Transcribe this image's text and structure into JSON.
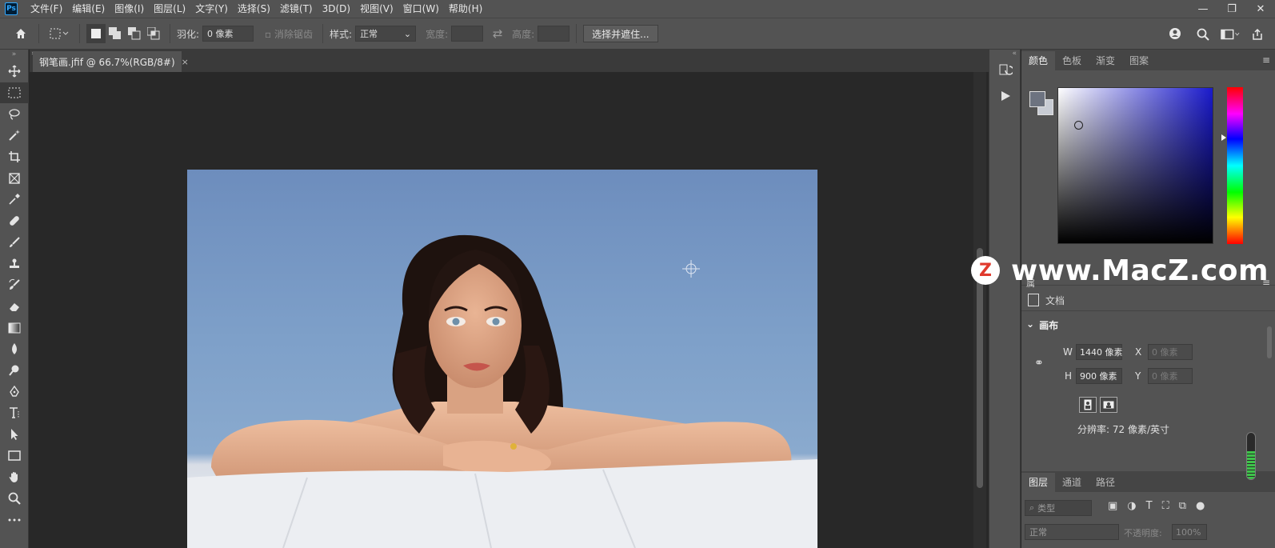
{
  "app": {
    "logo_text": "Ps"
  },
  "menu": [
    "文件(F)",
    "编辑(E)",
    "图像(I)",
    "图层(L)",
    "文字(Y)",
    "选择(S)",
    "滤镜(T)",
    "3D(D)",
    "视图(V)",
    "窗口(W)",
    "帮助(H)"
  ],
  "window_controls": {
    "minimize": "—",
    "restore": "❐",
    "close": "✕"
  },
  "options": {
    "feather_label": "羽化:",
    "feather_value": "0 像素",
    "antialias_label": "消除锯齿",
    "style_label": "样式:",
    "style_value": "正常",
    "width_label": "宽度:",
    "height_label": "高度:",
    "select_mask_button": "选择并遮住..."
  },
  "tools": [
    "move",
    "marquee",
    "lasso",
    "magic-wand",
    "crop",
    "frame",
    "eyedropper",
    "healing",
    "brush",
    "stamp",
    "history-brush",
    "eraser",
    "gradient",
    "blur",
    "dodge",
    "pen",
    "type",
    "path-select",
    "rectangle",
    "hand",
    "zoom",
    "more"
  ],
  "document": {
    "tab_title": "钢笔画.jfif @ 66.7%(RGB/8#)",
    "close": "×"
  },
  "color_panel": {
    "tabs": [
      "颜色",
      "色板",
      "渐变",
      "图案"
    ],
    "foreground": "#6d7380",
    "background": "#c8ccd4",
    "hue_color": "#1a1acc"
  },
  "watermark": {
    "logo": "Z",
    "text": "www.MacZ.com"
  },
  "properties": {
    "title": "属",
    "doc_label": "文档",
    "canvas_label": "画布",
    "w_label": "W",
    "w_value": "1440 像素",
    "h_label": "H",
    "h_value": "900 像素",
    "x_label": "X",
    "x_value": "0 像素",
    "y_label": "Y",
    "y_value": "0 像素",
    "resolution": "分辨率: 72 像素/英寸"
  },
  "layers_panel": {
    "tabs": [
      "图层",
      "通道",
      "路径"
    ],
    "filter_placeholder": "类型",
    "blend_mode": "正常",
    "opacity_label": "不透明度:",
    "opacity_value": "100%"
  }
}
